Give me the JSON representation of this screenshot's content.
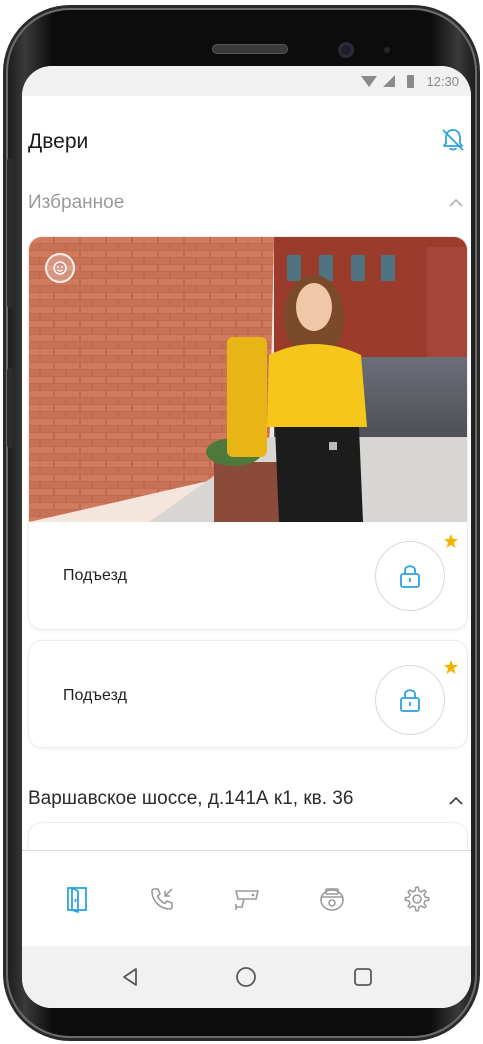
{
  "status_bar": {
    "time": "12:30"
  },
  "header": {
    "title": "Двери"
  },
  "favorites": {
    "title": "Избранное",
    "cards": [
      {
        "label": "Подъезд",
        "has_camera": true,
        "favorite": true
      },
      {
        "label": "Подъезд",
        "has_camera": false,
        "favorite": true
      }
    ]
  },
  "address_section": {
    "title": "Варшавское шоссе, д.141А к1, кв. 36"
  },
  "bottom_nav": {
    "items": [
      {
        "icon": "door-icon",
        "active": true
      },
      {
        "icon": "call-log-icon",
        "active": false
      },
      {
        "icon": "camera-icon",
        "active": false
      },
      {
        "icon": "intercom-icon",
        "active": false
      },
      {
        "icon": "settings-gear-icon",
        "active": false
      }
    ]
  },
  "colors": {
    "accent": "#2aa3e0",
    "star": "#f5b400",
    "muted_icon": "#9a9a9a",
    "status_bar_bg": "#f1f1f1"
  }
}
